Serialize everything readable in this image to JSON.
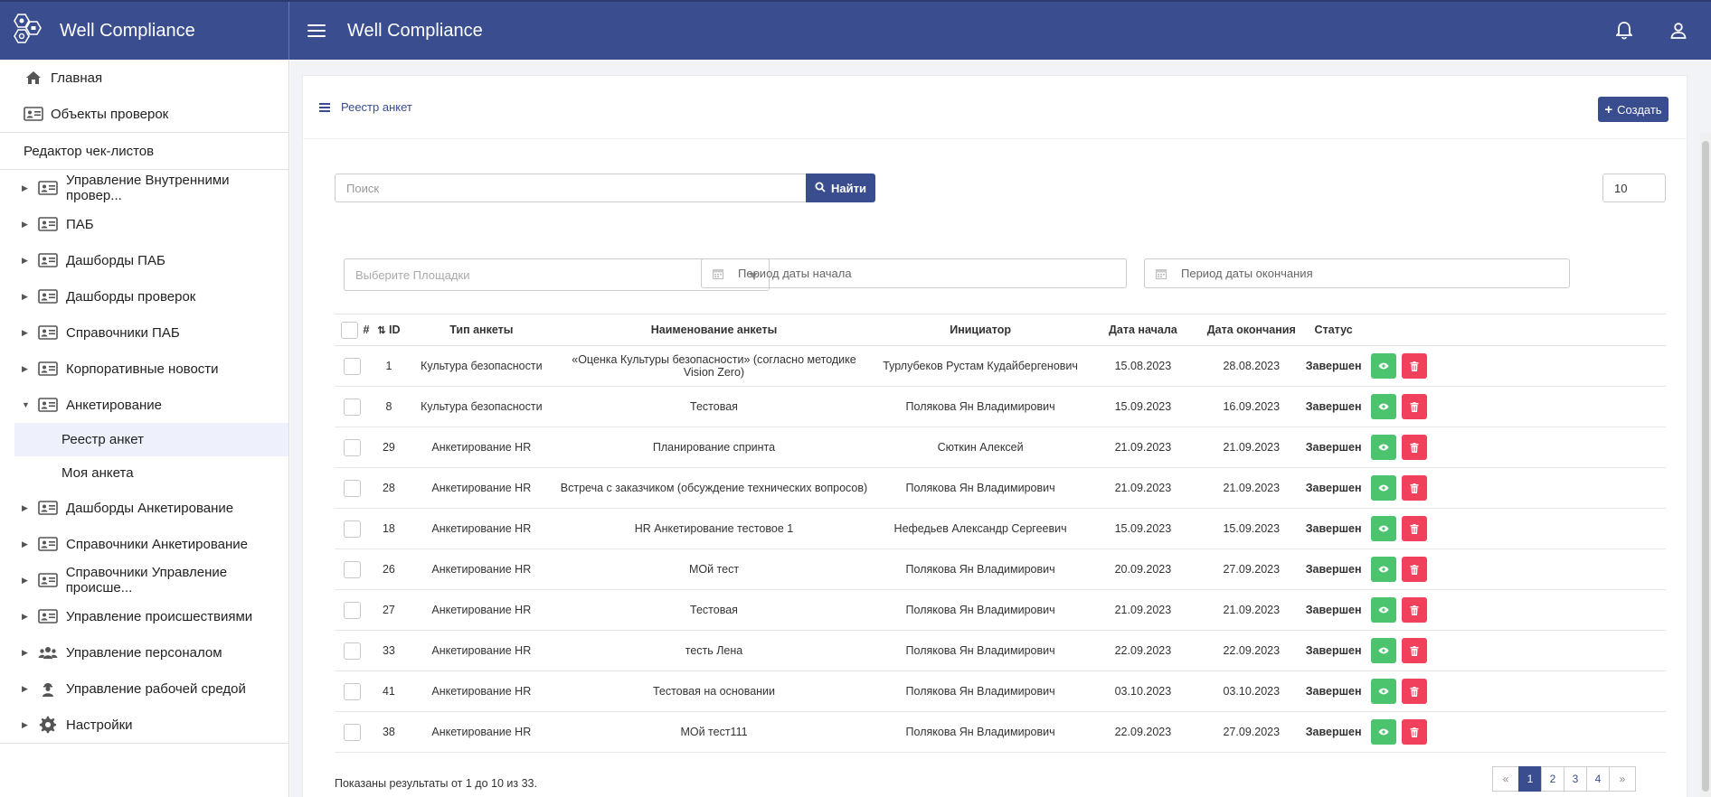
{
  "app": {
    "brand": "Well Compliance",
    "title": "Well Compliance"
  },
  "topbar_icons": [
    "bell-icon",
    "user-icon"
  ],
  "sidebar": {
    "top_items": [
      {
        "label": "Главная",
        "icon": "home-icon"
      },
      {
        "label": "Объекты проверок",
        "icon": "id-card-icon"
      }
    ],
    "section_header": "Редактор чек-листов",
    "groups_before": [
      {
        "label": "Управление Внутренними провер..."
      },
      {
        "label": "ПАБ"
      },
      {
        "label": "Дашборды ПАБ"
      },
      {
        "label": "Дашборды проверок"
      },
      {
        "label": "Справочники ПАБ"
      },
      {
        "label": "Корпоративные новости"
      }
    ],
    "expanded_group": {
      "label": "Анкетирование",
      "children": [
        "Реестр анкет",
        "Моя анкета"
      ]
    },
    "groups_after": [
      {
        "label": "Дашборды Анкетирование",
        "icon": "id-card-icon"
      },
      {
        "label": "Справочники Анкетирование",
        "icon": "id-card-icon"
      },
      {
        "label": "Справочники Управление происше...",
        "icon": "id-card-icon"
      },
      {
        "label": "Управление происшествиями",
        "icon": "id-card-icon"
      },
      {
        "label": "Управление персоналом",
        "icon": "users-icon"
      },
      {
        "label": "Управление рабочей средой",
        "icon": "worker-icon"
      },
      {
        "label": "Настройки",
        "icon": "gear-icon"
      }
    ]
  },
  "panel": {
    "title": "Реестр анкет",
    "create_label": "Создать"
  },
  "search": {
    "placeholder": "Поиск",
    "button": "Найти",
    "page_size": "10"
  },
  "filters": {
    "sites_placeholder": "Выберите Площадки",
    "start_placeholder": "Период даты начала",
    "end_placeholder": "Период даты окончания"
  },
  "table": {
    "headers": [
      "#",
      "ID",
      "Тип анкеты",
      "Наименование анкеты",
      "Инициатор",
      "Дата начала",
      "Дата окончания",
      "Статус"
    ],
    "rows": [
      {
        "id": "1",
        "type": "Культура безопасности",
        "name": "«Оценка Культуры безопасности» (согласно методике Vision Zero)",
        "initiator": "Турлубеков Рустам Кудайбергенович",
        "start": "15.08.2023",
        "end": "28.08.2023",
        "status": "Завершен"
      },
      {
        "id": "8",
        "type": "Культура безопасности",
        "name": "Тестовая",
        "initiator": "Полякова Ян Владимирович",
        "start": "15.09.2023",
        "end": "16.09.2023",
        "status": "Завершен"
      },
      {
        "id": "29",
        "type": "Анкетирование HR",
        "name": "Планирование спринта",
        "initiator": "Сюткин Алексей",
        "start": "21.09.2023",
        "end": "21.09.2023",
        "status": "Завершен"
      },
      {
        "id": "28",
        "type": "Анкетирование HR",
        "name": "Встреча с заказчиком (обсуждение технических вопросов)",
        "initiator": "Полякова Ян Владимирович",
        "start": "21.09.2023",
        "end": "21.09.2023",
        "status": "Завершен"
      },
      {
        "id": "18",
        "type": "Анкетирование HR",
        "name": "HR Анкетирование тестовое 1",
        "initiator": "Нефедьев Александр Сергеевич",
        "start": "15.09.2023",
        "end": "15.09.2023",
        "status": "Завершен"
      },
      {
        "id": "26",
        "type": "Анкетирование HR",
        "name": "МОй тест",
        "initiator": "Полякова Ян Владимирович",
        "start": "20.09.2023",
        "end": "27.09.2023",
        "status": "Завершен"
      },
      {
        "id": "27",
        "type": "Анкетирование HR",
        "name": "Тестовая",
        "initiator": "Полякова Ян Владимирович",
        "start": "21.09.2023",
        "end": "21.09.2023",
        "status": "Завершен"
      },
      {
        "id": "33",
        "type": "Анкетирование HR",
        "name": "тесть Лена",
        "initiator": "Полякова Ян Владимирович",
        "start": "22.09.2023",
        "end": "22.09.2023",
        "status": "Завершен"
      },
      {
        "id": "41",
        "type": "Анкетирование HR",
        "name": "Тестовая на основании",
        "initiator": "Полякова Ян Владимирович",
        "start": "03.10.2023",
        "end": "03.10.2023",
        "status": "Завершен"
      },
      {
        "id": "38",
        "type": "Анкетирование HR",
        "name": "МОй тест111",
        "initiator": "Полякова Ян Владимирович",
        "start": "22.09.2023",
        "end": "27.09.2023",
        "status": "Завершен"
      }
    ]
  },
  "footer": {
    "info": "Показаны результаты от 1 до 10 из 33."
  },
  "pagination": {
    "prev": "«",
    "pages": [
      "1",
      "2",
      "3",
      "4"
    ],
    "next": "»",
    "active": "1"
  },
  "colors": {
    "primary": "#3a4d8f",
    "success": "#4cc46e",
    "danger": "#f0405b",
    "status_text": "#1d7a1d"
  }
}
